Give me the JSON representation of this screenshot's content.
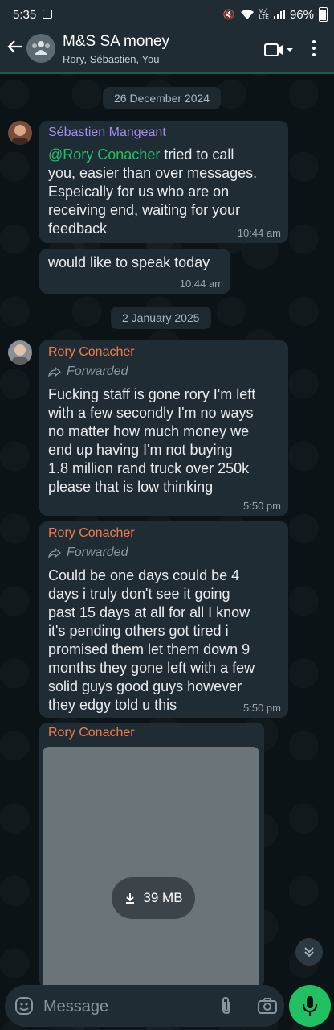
{
  "status_bar": {
    "time": "5:35",
    "battery": "96%"
  },
  "header": {
    "title": "M&S SA money",
    "subtitle": "Rory, Sébastien, You"
  },
  "dates": [
    "26 December 2024",
    "2 January 2025"
  ],
  "messages": [
    {
      "sender": "Sébastien Mangeant",
      "mention": "@Rory Conacher",
      "text_l1": " tried to call",
      "text_rest": [
        "you, easier than over messages.",
        "Espeically for us who are on",
        "receiving end, waiting for your",
        "feedback"
      ],
      "time": "10:44 am"
    },
    {
      "text": "would like to speak today",
      "time": "10:44 am"
    },
    {
      "sender": "Rory Conacher",
      "forwarded": "Forwarded",
      "lines": [
        "Fucking staff is gone rory I'm left",
        "with a few secondly I'm no ways",
        "no matter how much money we",
        "end up having I'm not buying",
        "1.8 million rand truck over 250k",
        "please that is low thinking"
      ],
      "time": "5:50 pm"
    },
    {
      "sender": "Rory Conacher",
      "forwarded": "Forwarded",
      "lines": [
        "Could be one days could be 4",
        "days  i truly don't see it going",
        "past 15 days at all for all I know",
        "it's pending others got tired i",
        "promised them let them down 9",
        "months they gone left with a few",
        "solid guys good guys however",
        "they edgy told u this"
      ],
      "time": "5:50 pm"
    },
    {
      "sender": "Rory Conacher",
      "file_size": "39 MB"
    }
  ],
  "composer": {
    "placeholder": "Message"
  },
  "colors": {
    "sender_sebastien": "#a58cf0",
    "sender_rory": "#f47b4a",
    "mention": "#21c063",
    "accent": "#21c063"
  },
  "icons": [
    "back-arrow-icon",
    "group-avatar-icon",
    "video-call-icon",
    "more-options-icon",
    "forwarded-icon",
    "download-icon",
    "chevron-down-icon",
    "emoji-icon",
    "attach-icon",
    "camera-icon",
    "mic-icon"
  ]
}
